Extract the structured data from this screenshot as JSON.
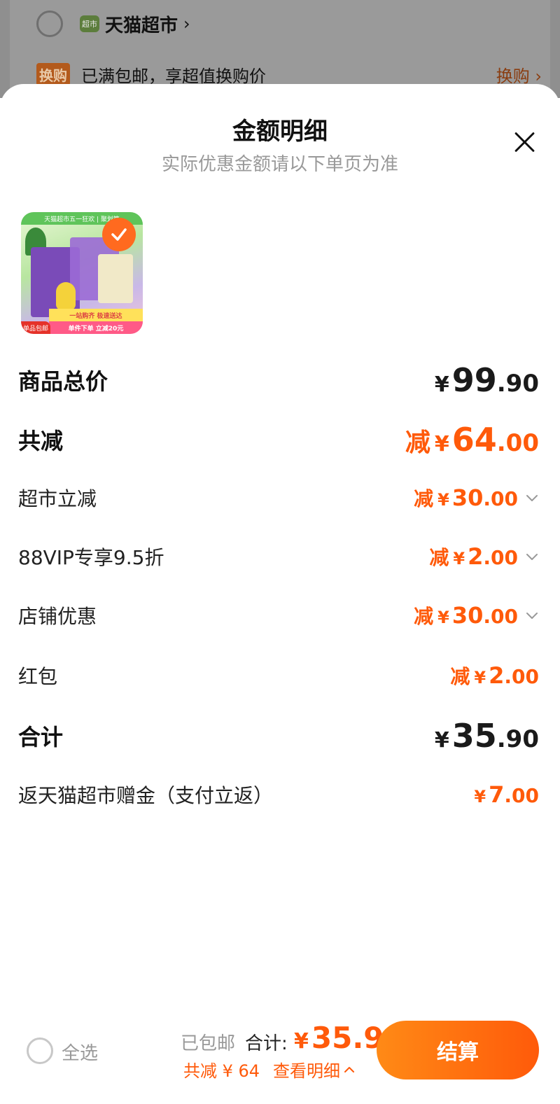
{
  "background": {
    "store_name": "天猫超市",
    "store_badge": "超市",
    "promo_tag": "换购",
    "promo_text": "已满包邮，享超值换购价",
    "promo_link": "换购 ›"
  },
  "sheet": {
    "title": "金额明细",
    "subtitle": "实际优惠金额请以下单页为准"
  },
  "product": {
    "banner": "天猫超市五一狂欢 | 聚划算",
    "strip1": "一站购齐 极速送达",
    "strip2": "单件下单 立减20元",
    "tag": "单品包邮",
    "selected": true
  },
  "rows": {
    "subtotal": {
      "label": "商品总价",
      "currency": "¥",
      "int": "99",
      "dec": ".90"
    },
    "total_discount": {
      "label": "共减",
      "prefix": "减",
      "currency": "¥",
      "int": "64",
      "dec": ".00"
    },
    "market_discount": {
      "label": "超市立减",
      "prefix": "减",
      "currency": "¥",
      "int": "30",
      "dec": ".00"
    },
    "vip_discount": {
      "label": "88VIP专享9.5折",
      "prefix": "减",
      "currency": "¥",
      "int": "2",
      "dec": ".00"
    },
    "store_discount": {
      "label": "店铺优惠",
      "prefix": "减",
      "currency": "¥",
      "int": "30",
      "dec": ".00"
    },
    "red_packet": {
      "label": "红包",
      "prefix": "减",
      "currency": "¥",
      "int": "2",
      "dec": ".00"
    },
    "total": {
      "label": "合计",
      "currency": "¥",
      "int": "35",
      "dec": ".90"
    },
    "cashback": {
      "label": "返天猫超市赠金（支付立返）",
      "currency": "¥",
      "int": "7",
      "dec": ".00"
    }
  },
  "footer": {
    "select_all": "全选",
    "shipping": "已包邮",
    "total_label": "合计:",
    "total_currency": "¥",
    "total_value": "35.9",
    "saved": "共减 ¥ 64",
    "detail_link": "查看明细",
    "checkout": "结算"
  },
  "colors": {
    "accent": "#ff5a0a",
    "overlay": "#8f8f8f"
  }
}
